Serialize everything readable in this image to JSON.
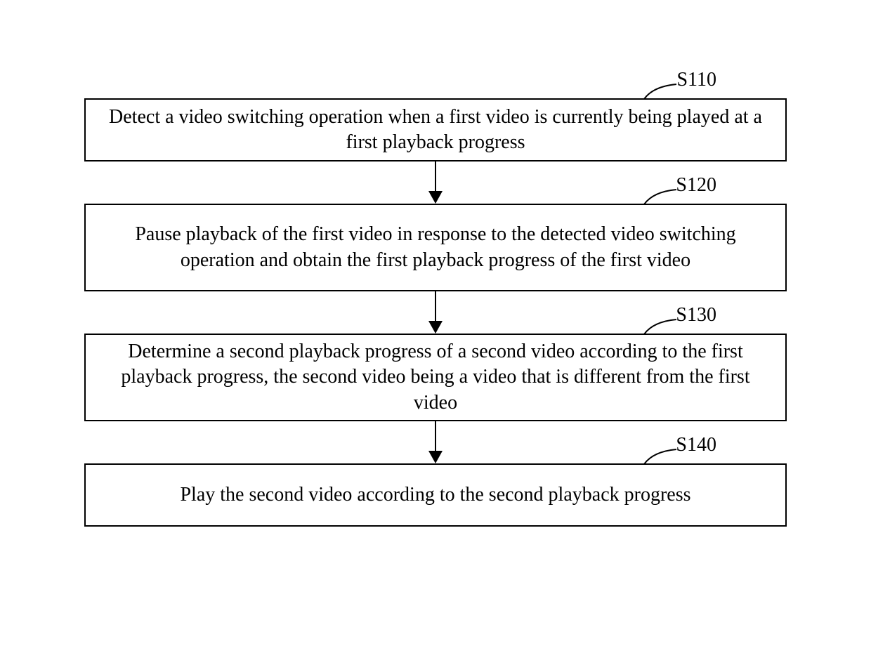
{
  "flowchart": {
    "steps": [
      {
        "label": "S110",
        "text": "Detect a video switching operation when a first video is currently being played at a first playback progress"
      },
      {
        "label": "S120",
        "text": "Pause playback of the first video in response to the detected video switching operation and obtain the first playback progress of the first video"
      },
      {
        "label": "S130",
        "text": "Determine a second playback progress of a second video according to the first playback progress, the second video being a video that is different from the first video"
      },
      {
        "label": "S140",
        "text": "Play the second video according to the second playback progress"
      }
    ]
  }
}
